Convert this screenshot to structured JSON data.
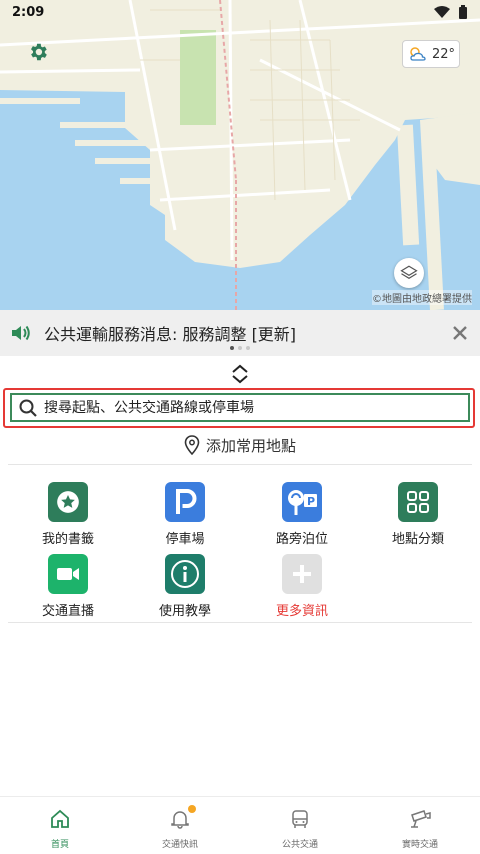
{
  "status_bar": {
    "time": "2:09"
  },
  "map": {
    "weather_temp": "22°",
    "credit": "©地圖由地政總署提供",
    "colors": {
      "water": "#a8d3f0",
      "land": "#f1efe0",
      "park": "#c8e3b0",
      "road": "#ffffff"
    }
  },
  "notice": {
    "text": "公共運輸服務消息: 服務調整 [更新]",
    "close_icon": "close-icon"
  },
  "search": {
    "placeholder": "搜尋起點、公共交通路線或停車場"
  },
  "add_favourite": {
    "label": "添加常用地點"
  },
  "shortcuts": [
    {
      "label": "我的書籤",
      "icon": "star-icon",
      "color": "#2e7d5b"
    },
    {
      "label": "停車場",
      "icon": "parking-icon",
      "color": "#3b7ddd"
    },
    {
      "label": "路旁泊位",
      "icon": "meter-parking-icon",
      "color": "#3b7ddd"
    },
    {
      "label": "地點分類",
      "icon": "grid-icon",
      "color": "#2e7d5b"
    },
    {
      "label": "交通直播",
      "icon": "video-camera-icon",
      "color": "#1db36b"
    },
    {
      "label": "使用教學",
      "icon": "info-icon",
      "color": "#1e7d6a"
    },
    {
      "label": "更多資訊",
      "icon": "plus-icon",
      "color": "#e0e0e0",
      "label_color": "#e53935"
    }
  ],
  "bottom_nav": [
    {
      "label": "首頁",
      "icon": "home-icon",
      "active": true
    },
    {
      "label": "交通快訊",
      "icon": "bell-icon",
      "active": false
    },
    {
      "label": "公共交通",
      "icon": "bus-icon",
      "active": false
    },
    {
      "label": "實時交通",
      "icon": "camera-icon",
      "active": false
    }
  ],
  "accent_color": "#2e8b57",
  "highlight_color": "#e53935"
}
